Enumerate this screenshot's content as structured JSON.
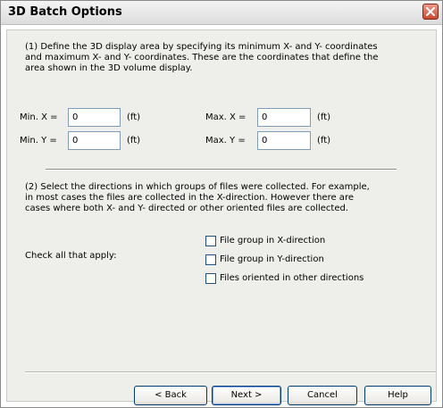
{
  "window": {
    "title": "3D Batch Options"
  },
  "section1": {
    "description": "(1) Define the 3D display area by specifying its minimum X- and Y- coordinates and maximum X- and Y- coordinates. These are the coordinates that define the area shown in the 3D volume display.",
    "min_x_label": "Min. X =",
    "min_x_value": "0",
    "min_y_label": "Min. Y =",
    "min_y_value": "0",
    "max_x_label": "Max. X =",
    "max_x_value": "0",
    "max_y_label": "Max. Y =",
    "max_y_value": "0",
    "unit": "(ft)"
  },
  "section2": {
    "description": "(2) Select the directions in which groups of files were collected. For example, in most cases the files are collected in the X-direction. However there are cases where both X- and Y- directed or other oriented files are collected.",
    "check_label": "Check all that apply:",
    "options": [
      {
        "label": "File group in X-direction",
        "checked": false
      },
      {
        "label": "File group in Y-direction",
        "checked": false
      },
      {
        "label": "Files oriented in other directions",
        "checked": false
      }
    ]
  },
  "buttons": {
    "back": "< Back",
    "next": "Next >",
    "cancel": "Cancel",
    "help": "Help"
  }
}
